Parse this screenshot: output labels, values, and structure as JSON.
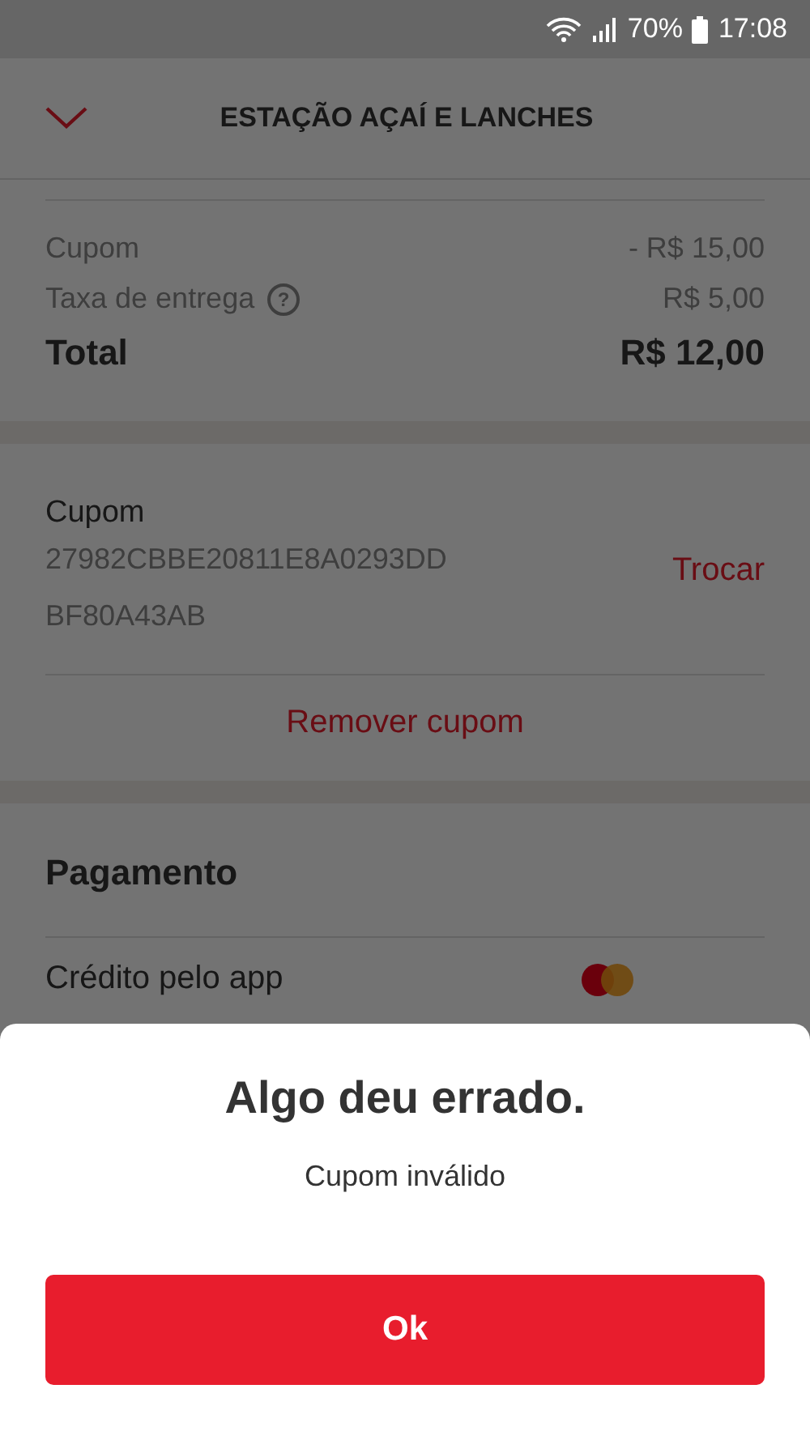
{
  "status_bar": {
    "battery": "70%",
    "time": "17:08"
  },
  "header": {
    "title": "ESTAÇÃO AÇAÍ E LANCHES"
  },
  "summary": {
    "rows": [
      {
        "label": "Cupom",
        "value": "- R$ 15,00",
        "kind": "plain"
      },
      {
        "label": "Taxa de entrega",
        "value": "R$ 5,00",
        "kind": "help",
        "help": "?"
      },
      {
        "label": "Total",
        "value": "R$ 12,00",
        "kind": "total"
      }
    ]
  },
  "coupon": {
    "title": "Cupom",
    "code_lines": [
      "27982CBBE20811E8A0293DD",
      "BF80A43AB"
    ],
    "change": "Trocar",
    "remove": "Remover cupom"
  },
  "payment": {
    "title": "Pagamento",
    "method": "Crédito pelo app"
  },
  "dialog": {
    "title": "Algo deu errado.",
    "message": "Cupom inválido",
    "button": "Ok"
  }
}
